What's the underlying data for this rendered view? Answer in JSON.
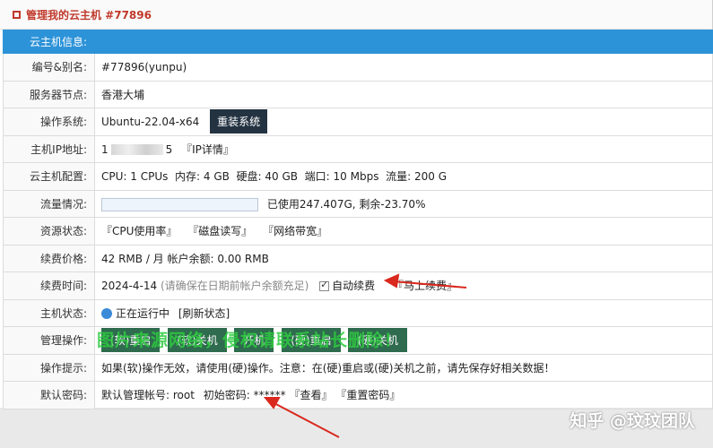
{
  "header": {
    "title": "管理我的云主机 #77896"
  },
  "section_header": "云主机信息:",
  "rows": {
    "id": {
      "label": "编号&别名:",
      "value": "#77896(yunpu)"
    },
    "node": {
      "label": "服务器节点:",
      "value": "香港大埔"
    },
    "os": {
      "label": "操作系统:",
      "value": "Ubuntu-22.04-x64",
      "button": "重装系统"
    },
    "ip": {
      "label": "主机IP地址:",
      "prefix": "1",
      "suffix": "5",
      "link": "『IP详情』"
    },
    "config": {
      "label": "云主机配置:",
      "cpu_label": "CPU:",
      "cpu": "1 CPUs",
      "mem_label": "内存:",
      "mem": "4 GB",
      "disk_label": "硬盘:",
      "disk": "40 GB",
      "port_label": "端口:",
      "port": "10 Mbps",
      "traffic_label": "流量:",
      "traffic": "200 G"
    },
    "traffic": {
      "label": "流量情况:",
      "text": "已使用247.407G, 剩余-23.70%"
    },
    "resources": {
      "label": "资源状态:",
      "cpu": "『CPU使用率』",
      "disk": "『磁盘读写』",
      "net": "『网络带宽』"
    },
    "price": {
      "label": "续费价格:",
      "value": "42 RMB / 月",
      "balance_label": "帐户余额:",
      "balance": "0.00 RMB"
    },
    "renew": {
      "label": "续费时间:",
      "date": "2024-4-14",
      "hint": "(请确保在日期前帐户余额充足)",
      "auto_label": "自动续费",
      "renew_now": "『马上续费』"
    },
    "status": {
      "label": "主机状态:",
      "value": "正在运行中",
      "refresh": "[刷新状态]"
    },
    "ops": {
      "label": "管理操作:",
      "buttons": [
        "(软)重启",
        "(软)关机",
        "开机",
        "(硬)重启",
        "(硬)关机"
      ]
    },
    "tips": {
      "label": "操作提示:",
      "value": "如果(软)操作无效，请使用(硬)操作。注意：在(硬)重启或(硬)关机之前，请先保存好相关数据！"
    },
    "password": {
      "label": "默认密码:",
      "account_label": "默认管理帐号:",
      "account": "root",
      "pwd_label": "初始密码:",
      "pwd": "******",
      "view": "『查看』",
      "reset": "『重置密码』"
    }
  },
  "watermark": "图片来源网络，侵权请联系站长删除！",
  "brand": "知乎 @玟玟团队",
  "colors": {
    "header_blue": "#2d93d8",
    "title_red": "#c0392b",
    "btn_green": "#2f6b4e",
    "btn_dark": "#243342",
    "arrow": "#d9281e"
  }
}
